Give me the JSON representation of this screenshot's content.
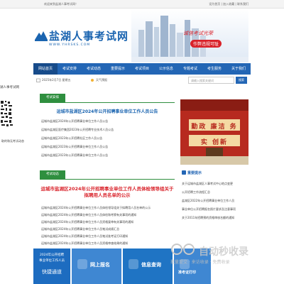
{
  "topbar": {
    "welcome": "欢迎来到盐湖人事考试网！",
    "links": "设为首页 | 加入收藏 | 联系我们"
  },
  "logo": {
    "cn": "盐湖人事考试网",
    "en": "WWW.YHRSKS.COM"
  },
  "banner": {
    "slogan1": "诚信考试光荣",
    "slogan2": "作弊违规可耻"
  },
  "nav": {
    "items": [
      "网站首页",
      "考试安排",
      "考试动态",
      "重要提示",
      "考试项目",
      "公示信息",
      "专题考试",
      "考生服务",
      "关于我们"
    ]
  },
  "infobar": {
    "date": "2025年2月7日 星期五",
    "weather": "天气预报"
  },
  "search": {
    "placeholder": "请输入搜索关键词",
    "button": "搜索"
  },
  "left_side": {
    "text1": "湖人事考试网",
    "text2": "取的和无考试动态"
  },
  "section1": {
    "tab": "考试安排",
    "headline": "运城市盐湖区2024年公开招聘事业单位工作人员公告",
    "items": [
      "运城市盐湖区2024年公开招聘事业单位工作人员公告",
      "运城市盐湖区医疗集团2023年公开招聘专业技术人员公告",
      "运城市盐湖区2023年公开招聘社区工作人员公告",
      "运城市盐湖区2023年公开招聘事业单位工作人员公告",
      "运城市盐湖区2023年公开招聘事业单位工作人员公告"
    ]
  },
  "section2": {
    "tab": "考试动态",
    "headline": "运城市盐湖区2024年公开招聘事业单位工作人员体检领导组关于拟聘用人员名单的公示",
    "items": [
      "运城市盐湖区2024年公开招聘事业单位工作人员体检领导组关于拟聘用人员名单的公示",
      "运城市盐湖区2024年公开招聘事业单位工作人员体检和考察有关事项的通知",
      "运城市盐湖区2024年公开招聘事业单位工作人员资格复审有关事项的通知",
      "运城市盐湖区2024年公开招聘事业单位工作人员笔试成绩汇总",
      "运城市盐湖区2024年公开招聘事业单位工作人员笔试准考证打印通知",
      "运城市盐湖区2024年公开招聘事业单位工作人员资格审查结果的通知"
    ]
  },
  "photo": {
    "text": "勤政 廉洁 务实 创新"
  },
  "side_panel": {
    "title": "重要提示",
    "items": [
      "关于运城市盐湖区人事考试中心地点变更",
      "公开招聘工作流程汇总",
      "盐湖区2022年公开招聘事业单位工作人员",
      "事业单位公开招聘报名照片要求及注意事项",
      "关于2011年招聘预的资格审核名额的通知"
    ]
  },
  "fast_channel": {
    "line1": "2024年公开招聘",
    "line2": "事业单位工作人员",
    "line3": "快捷通道"
  },
  "tiles": [
    {
      "label": "网上报名",
      "icon": "signup-icon",
      "color": "#3f87d2"
    },
    {
      "label": "信息查询",
      "icon": "search-icon",
      "color": "#1f74c4"
    },
    {
      "label": "准考证打印",
      "icon": "print-icon",
      "color": "#3f87d2"
    }
  ],
  "watermark": {
    "big": "自动秒收录",
    "small": "批量提交 · 来访收录 · 免费收录"
  }
}
